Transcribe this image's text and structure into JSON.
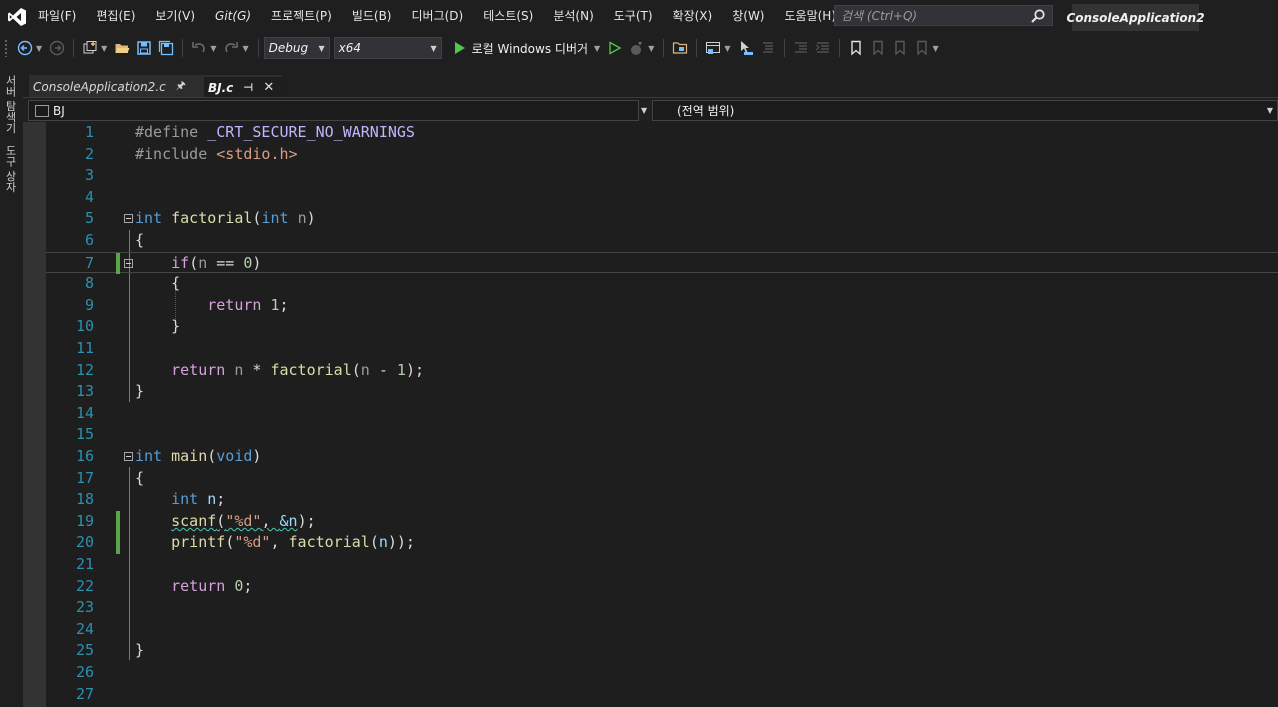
{
  "menu": {
    "items": [
      "파일(F)",
      "편집(E)",
      "보기(V)",
      "Git(G)",
      "프로젝트(P)",
      "빌드(B)",
      "디버그(D)",
      "테스트(S)",
      "분석(N)",
      "도구(T)",
      "확장(X)",
      "창(W)",
      "도움말(H)"
    ],
    "search_placeholder": "검색 (Ctrl+Q)",
    "solution_name": "ConsoleApplication2"
  },
  "toolbar": {
    "configuration": "Debug",
    "platform": "x64",
    "run_label": "로컬 Windows 디버거"
  },
  "side_tabs": [
    "서버 탐색기",
    "도구 상자"
  ],
  "tabs": [
    {
      "label": "ConsoleApplication2.c",
      "active": false
    },
    {
      "label": "BJ.c",
      "active": true
    }
  ],
  "navbar": {
    "scope_left": "BJ",
    "scope_right": "(전역 범위)"
  },
  "code": {
    "line_numbers": [
      "1",
      "2",
      "3",
      "4",
      "5",
      "6",
      "7",
      "8",
      "9",
      "10",
      "11",
      "12",
      "13",
      "14",
      "15",
      "16",
      "17",
      "18",
      "19",
      "20",
      "21",
      "22",
      "23",
      "24",
      "25",
      "26",
      "27"
    ],
    "tokens": {
      "l1": [
        "#define ",
        "_CRT_SECURE_NO_WARNINGS"
      ],
      "l2": [
        "#include ",
        "<stdio.h>"
      ],
      "l5": [
        "int",
        " ",
        "factorial",
        "(",
        "int",
        " ",
        "n",
        ")"
      ],
      "l6": [
        "{"
      ],
      "l7": [
        "    ",
        "if",
        "(",
        "n",
        " == ",
        "0",
        ")"
      ],
      "l8": [
        "    ",
        "{"
      ],
      "l9": [
        "        ",
        "return",
        " ",
        "1",
        ";"
      ],
      "l10": [
        "    ",
        "}"
      ],
      "l12": [
        "    ",
        "return",
        " ",
        "n",
        " * ",
        "factorial",
        "(",
        "n",
        " - ",
        "1",
        ");"
      ],
      "l13": [
        "}"
      ],
      "l16": [
        "int",
        " ",
        "main",
        "(",
        "void",
        ")"
      ],
      "l17": [
        "{"
      ],
      "l18": [
        "    ",
        "int",
        " ",
        "n",
        ";"
      ],
      "l19": [
        "    ",
        "scanf",
        "(",
        "\"%d\"",
        ", ",
        "&n",
        ");"
      ],
      "l20": [
        "    ",
        "printf",
        "(",
        "\"%d\"",
        ", ",
        "factorial",
        "(",
        "n",
        "));"
      ],
      "l22": [
        "    ",
        "return",
        " ",
        "0",
        ";"
      ],
      "l25": [
        "}"
      ]
    }
  },
  "colors": {
    "background": "#1e1e1e",
    "keyword": "#569cd6",
    "control_keyword": "#d8a0df",
    "function": "#dcdcaa",
    "number": "#b5cea8",
    "string": "#d69d85",
    "line_number": "#2b91af",
    "change_marker": "#57a64a"
  }
}
